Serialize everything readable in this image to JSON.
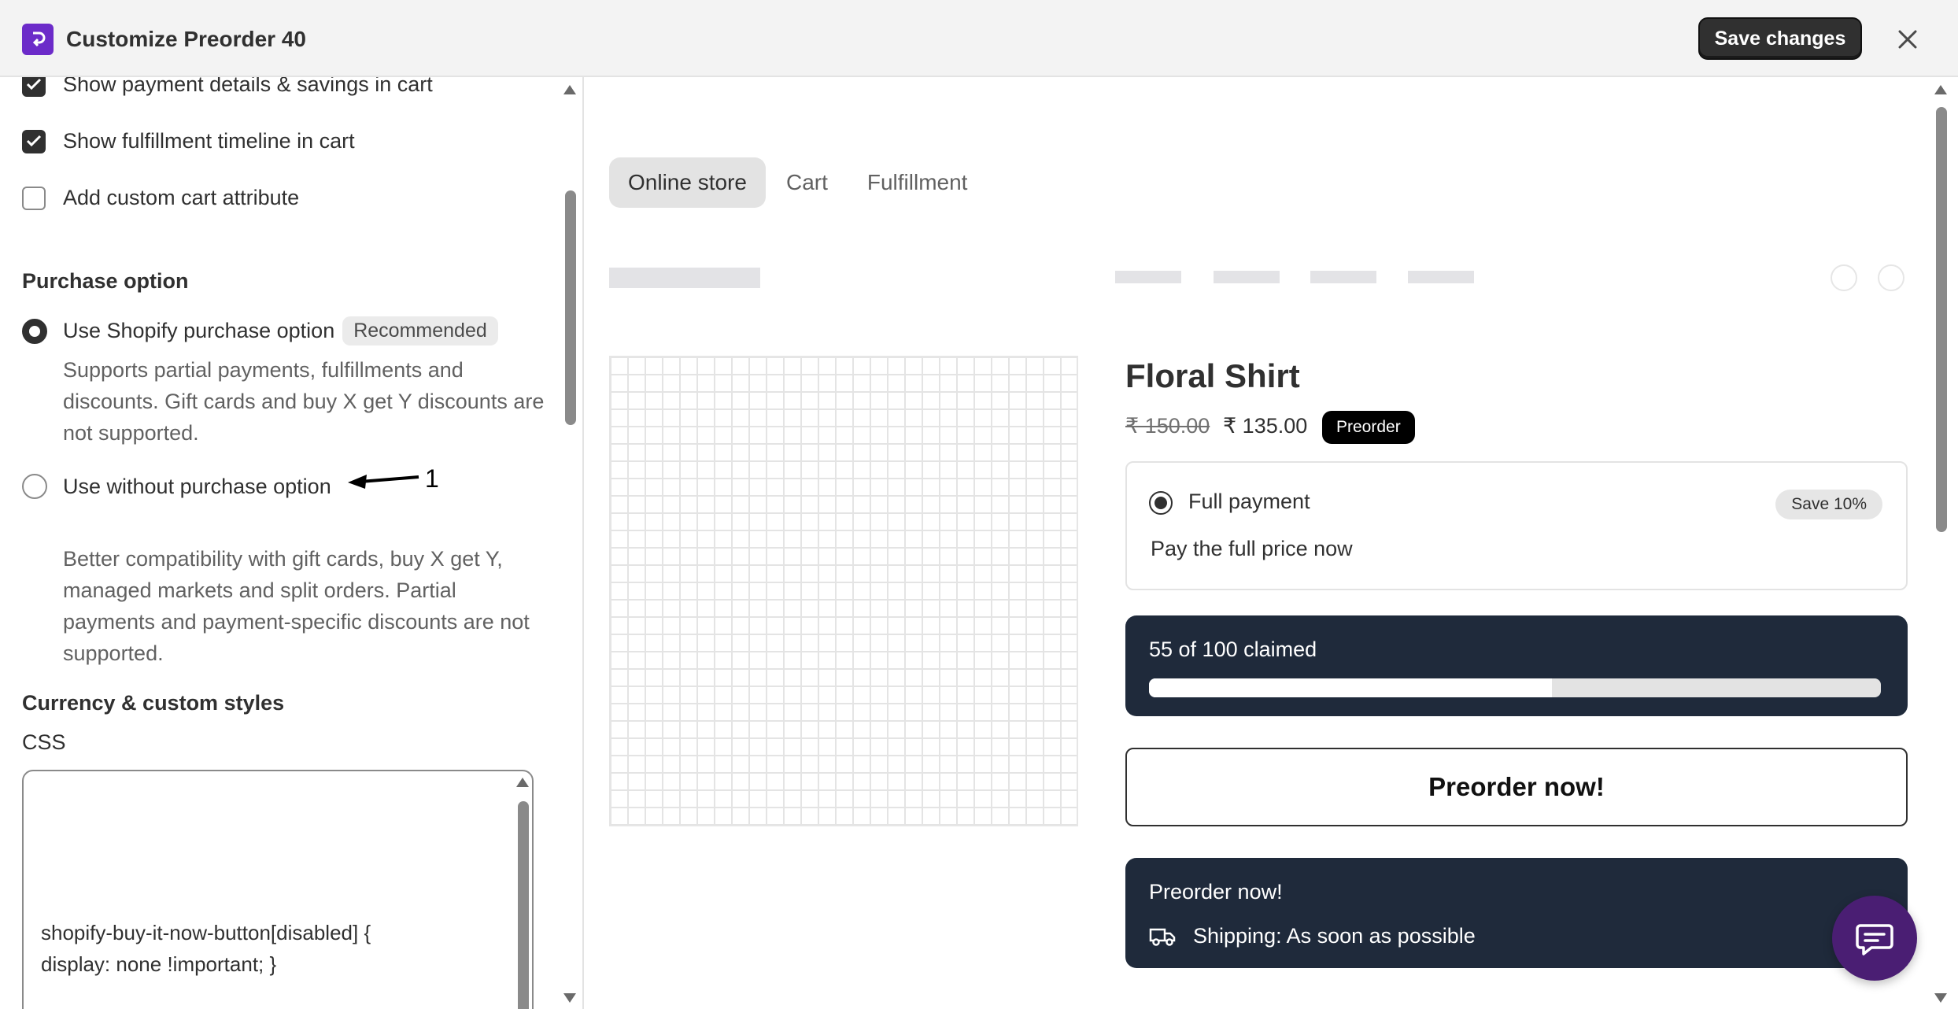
{
  "header": {
    "title": "Customize Preorder 40",
    "save_label": "Save changes"
  },
  "left_panel": {
    "checkboxes": [
      {
        "label": "Show payment details & savings in cart",
        "checked": true
      },
      {
        "label": "Show fulfillment timeline in cart",
        "checked": true
      },
      {
        "label": "Add custom cart attribute",
        "checked": false
      }
    ],
    "purchase_option": {
      "title": "Purchase option",
      "options": [
        {
          "label": "Use Shopify purchase option",
          "badge": "Recommended",
          "selected": true,
          "help": "Supports partial payments, fulfillments and discounts. Gift cards and buy X get Y discounts are not supported."
        },
        {
          "label": "Use without purchase option",
          "selected": false,
          "help": "Better compatibility with gift cards, buy X get Y, managed markets and split orders. Partial payments and payment-specific discounts are not supported."
        }
      ],
      "annotation": "1"
    },
    "currency_styles": {
      "title": "Currency & custom styles",
      "css_label": "CSS",
      "css_lines": [
        "shopify-buy-it-now-button[disabled] {",
        "display: none !important; }"
      ]
    }
  },
  "preview": {
    "tabs": [
      "Online store",
      "Cart",
      "Fulfillment"
    ],
    "active_tab": "Online store",
    "product": {
      "title": "Floral Shirt",
      "price_old": "₹ 150.00",
      "price_new": "₹ 135.00",
      "badge": "Preorder"
    },
    "payment": {
      "label": "Full payment",
      "save_badge": "Save 10%",
      "description": "Pay the full price now"
    },
    "claims": {
      "text": "55 of 100 claimed",
      "claimed": 55,
      "total": 100
    },
    "preorder_button": "Preorder now!",
    "shipping": {
      "title": "Preorder now!",
      "text": "Shipping: As soon as possible"
    }
  },
  "colors": {
    "brand": "#6c2bc9",
    "dark_card": "#1f2a3b",
    "chat_button": "#4a1e73"
  }
}
